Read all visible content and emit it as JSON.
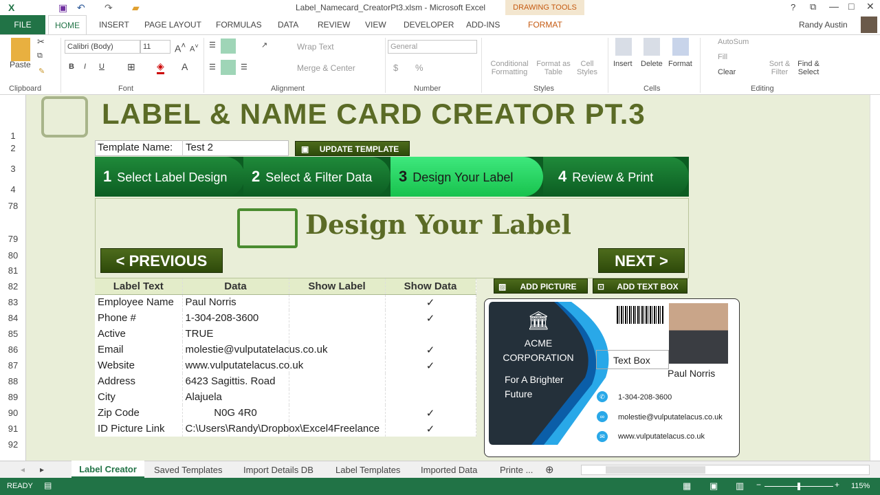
{
  "window": {
    "title": "Label_Namecard_CreatorPt3.xlsm - Microsoft Excel",
    "context_tab": "DRAWING TOOLS",
    "user": "Randy Austin"
  },
  "tabs": [
    "FILE",
    "HOME",
    "INSERT",
    "PAGE LAYOUT",
    "FORMULAS",
    "DATA",
    "REVIEW",
    "VIEW",
    "DEVELOPER",
    "ADD-INS",
    "FORMAT"
  ],
  "ribbon": {
    "clipboard": {
      "paste": "Paste",
      "group": "Clipboard"
    },
    "font": {
      "name": "Calibri (Body)",
      "size": "11",
      "group": "Font",
      "bold": "B",
      "italic": "I",
      "underline": "U"
    },
    "alignment": {
      "wrap": "Wrap Text",
      "merge": "Merge & Center",
      "group": "Alignment"
    },
    "number": {
      "format": "General",
      "currency": "$",
      "percent": "%",
      "group": "Number"
    },
    "styles": {
      "conditional": "Conditional Formatting",
      "table": "Format as Table",
      "cell": "Cell Styles",
      "group": "Styles"
    },
    "cells": {
      "insert": "Insert",
      "delete": "Delete",
      "format": "Format",
      "group": "Cells"
    },
    "editing": {
      "autosum": "AutoSum",
      "fill": "Fill",
      "clear": "Clear",
      "sort": "Sort & Filter",
      "find": "Find & Select",
      "group": "Editing"
    }
  },
  "rows": [
    "1",
    "2",
    "3",
    "4",
    "78",
    "79",
    "80",
    "81",
    "82",
    "83",
    "84",
    "85",
    "86",
    "87",
    "88",
    "89",
    "90",
    "91",
    "92"
  ],
  "sheet": {
    "title": "LABEL & NAME CARD CREATOR PT.3",
    "template_label": "Template Name:",
    "template_value": "Test 2",
    "update_button": "UPDATE TEMPLATE",
    "steps": [
      {
        "n": "1",
        "label": "Select Label Design"
      },
      {
        "n": "2",
        "label": "Select & Filter Data"
      },
      {
        "n": "3",
        "label": "Design Your Label"
      },
      {
        "n": "4",
        "label": "Review & Print"
      }
    ],
    "section_title": "Design Your Label",
    "previous": "< PREVIOUS",
    "next": "NEXT >",
    "add_picture": "ADD PICTURE",
    "add_text_box": "ADD TEXT BOX",
    "headers": [
      "Label Text",
      "Data",
      "Show Label",
      "Show Data"
    ],
    "table": [
      [
        "Employee Name",
        "Paul Norris",
        "",
        "✓"
      ],
      [
        "Phone #",
        "1-304-208-3600",
        "",
        "✓"
      ],
      [
        "Active",
        "TRUE",
        "",
        ""
      ],
      [
        "Email",
        "molestie@vulputatelacus.co.uk",
        "",
        "✓"
      ],
      [
        "Website",
        "www.vulputatelacus.co.uk",
        "",
        "✓"
      ],
      [
        "Address",
        "6423 Sagittis. Road",
        "",
        ""
      ],
      [
        "City",
        "Alajuela",
        "",
        ""
      ],
      [
        "Zip Code",
        "N0G 4R0",
        "",
        "✓"
      ],
      [
        "ID Picture Link",
        "C:\\Users\\Randy\\Dropbox\\Excel4Freelance",
        "",
        "✓"
      ]
    ]
  },
  "card": {
    "company1": "ACME",
    "company2": "CORPORATION",
    "slogan1": "For A Brighter",
    "slogan2": "Future",
    "textbox": "Text Box",
    "name": "Paul Norris",
    "phone": "1-304-208-3600",
    "email": "molestie@vulputatelacus.co.uk",
    "web": "www.vulputatelacus.co.uk"
  },
  "sheet_tabs": [
    "Label Creator",
    "Saved Templates",
    "Import Details DB",
    "Label Templates",
    "Imported Data",
    "Printe ..."
  ],
  "status": {
    "ready": "READY",
    "zoom": "115%"
  },
  "colors": {
    "excel_green": "#217346",
    "sheet_bg": "#e9eed8",
    "title_olive": "#5b6b26",
    "card_dark": "#24303a",
    "card_blue": "#29a8e8"
  }
}
